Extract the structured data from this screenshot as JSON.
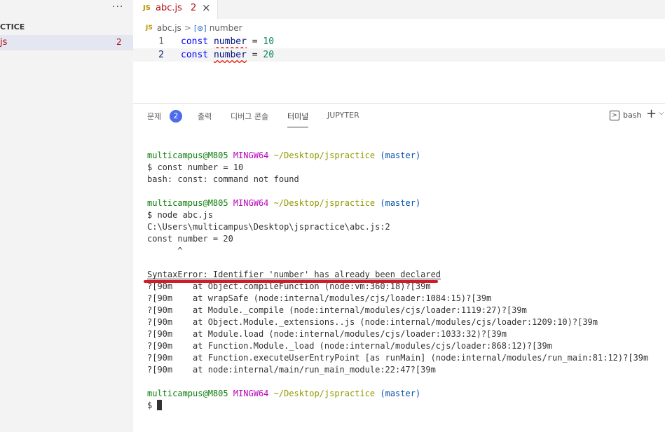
{
  "sidebar": {
    "more_icon": "ellipsis-icon",
    "project_title": "CTICE",
    "file_name": "js",
    "file_problem_count": "2"
  },
  "editor": {
    "tab": {
      "icon_label": "JS",
      "name": "abc.js",
      "problem_count": "2",
      "close_glyph": "×"
    },
    "breadcrumb": {
      "icon_label": "JS",
      "file": "abc.js",
      "separator": ">",
      "symbol_icon": "[⊛]",
      "symbol": "number"
    },
    "lines": [
      {
        "number": "1",
        "keyword": "const",
        "variable": "number",
        "operator": "=",
        "value": "10"
      },
      {
        "number": "2",
        "keyword": "const",
        "variable": "number",
        "operator": "=",
        "value": "20"
      }
    ]
  },
  "panel": {
    "tabs": [
      {
        "label": "문제"
      },
      {
        "label": "출력"
      },
      {
        "label": "디버그 콘솔"
      },
      {
        "label": "터미널"
      },
      {
        "label": "JUPYTER"
      }
    ],
    "problems_badge": "2",
    "terminal_name": "bash",
    "terminal_icon": ">",
    "add_icon": "+",
    "dropdown_icon": "⌵"
  },
  "terminal": {
    "prompt1": {
      "user": "multicampus@M805",
      "host": "MINGW64",
      "path": "~/Desktop/jspractice",
      "branch": "(master)"
    },
    "cmd1": "$ const number = 10",
    "out1": "bash: const: command not found",
    "prompt2": {
      "user": "multicampus@M805",
      "host": "MINGW64",
      "path": "~/Desktop/jspractice",
      "branch": "(master)"
    },
    "cmd2": "$ node abc.js",
    "out2": [
      "C:\\Users\\multicampus\\Desktop\\jspractice\\abc.js:2",
      "const number = 20",
      "      ^"
    ],
    "error": "SyntaxError: Identifier 'number' has already been declared",
    "stack": [
      "?[90m    at Object.compileFunction (node:vm:360:18)?[39m",
      "?[90m    at wrapSafe (node:internal/modules/cjs/loader:1084:15)?[39m",
      "?[90m    at Module._compile (node:internal/modules/cjs/loader:1119:27)?[39m",
      "?[90m    at Object.Module._extensions..js (node:internal/modules/cjs/loader:1209:10)?[39m",
      "?[90m    at Module.load (node:internal/modules/cjs/loader:1033:32)?[39m",
      "?[90m    at Function.Module._load (node:internal/modules/cjs/loader:868:12)?[39m",
      "?[90m    at Function.executeUserEntryPoint [as runMain] (node:internal/modules/run_main:81:12)?[39m",
      "?[90m    at node:internal/main/run_main_module:22:47?[39m"
    ],
    "prompt3": {
      "user": "multicampus@M805",
      "host": "MINGW64",
      "path": "~/Desktop/jspractice",
      "branch": "(master)"
    },
    "cmd3": "$ "
  },
  "colors": {
    "error_red": "#b01011",
    "badge_blue": "#4f6bed",
    "annotation_red": "#d11a2a"
  }
}
